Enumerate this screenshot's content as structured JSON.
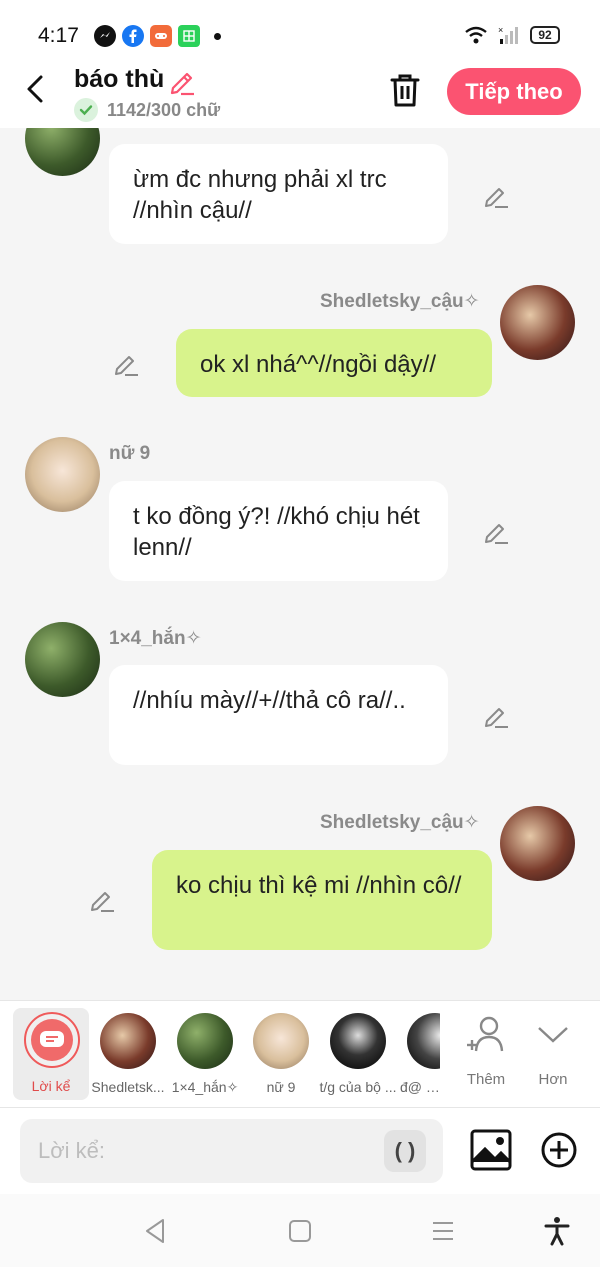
{
  "status": {
    "time": "4:17",
    "battery": "92",
    "apps": [
      "messenger-icon",
      "facebook-icon",
      "game-icon",
      "sheet-icon"
    ]
  },
  "header": {
    "title": "báo thù",
    "word_count": "1142/300 chữ",
    "next_label": "Tiếp theo",
    "colors": {
      "accent": "#fb5371",
      "check": "#4caf50"
    }
  },
  "messages": [
    {
      "text": "ừm đc nhưng phải xl trc //nhìn cậu//"
    },
    {
      "sender": "Shedletsky_cậu✧",
      "text": "ok xl nhá^^//ngồi dậy//"
    },
    {
      "sender": "nữ 9",
      "text": "t ko đồng ý?! //khó chịu hét lenn//"
    },
    {
      "sender": "1×4_hắn✧",
      "text": "//nhíu mày//+//thả cô ra//.."
    },
    {
      "sender": "Shedletsky_cậu✧",
      "text": "ko chịu thì kệ mi //nhìn cô//"
    }
  ],
  "characters": {
    "narrator_label": "Lời kể",
    "items": [
      "Shedletsk...",
      "1×4_hắn✧",
      "nữ 9",
      "t/g của bộ ...",
      "đ@ nh"
    ],
    "add_label": "Thêm",
    "more_label": "Hơn"
  },
  "input": {
    "placeholder": "Lời kể:",
    "paren_label": "( )"
  }
}
